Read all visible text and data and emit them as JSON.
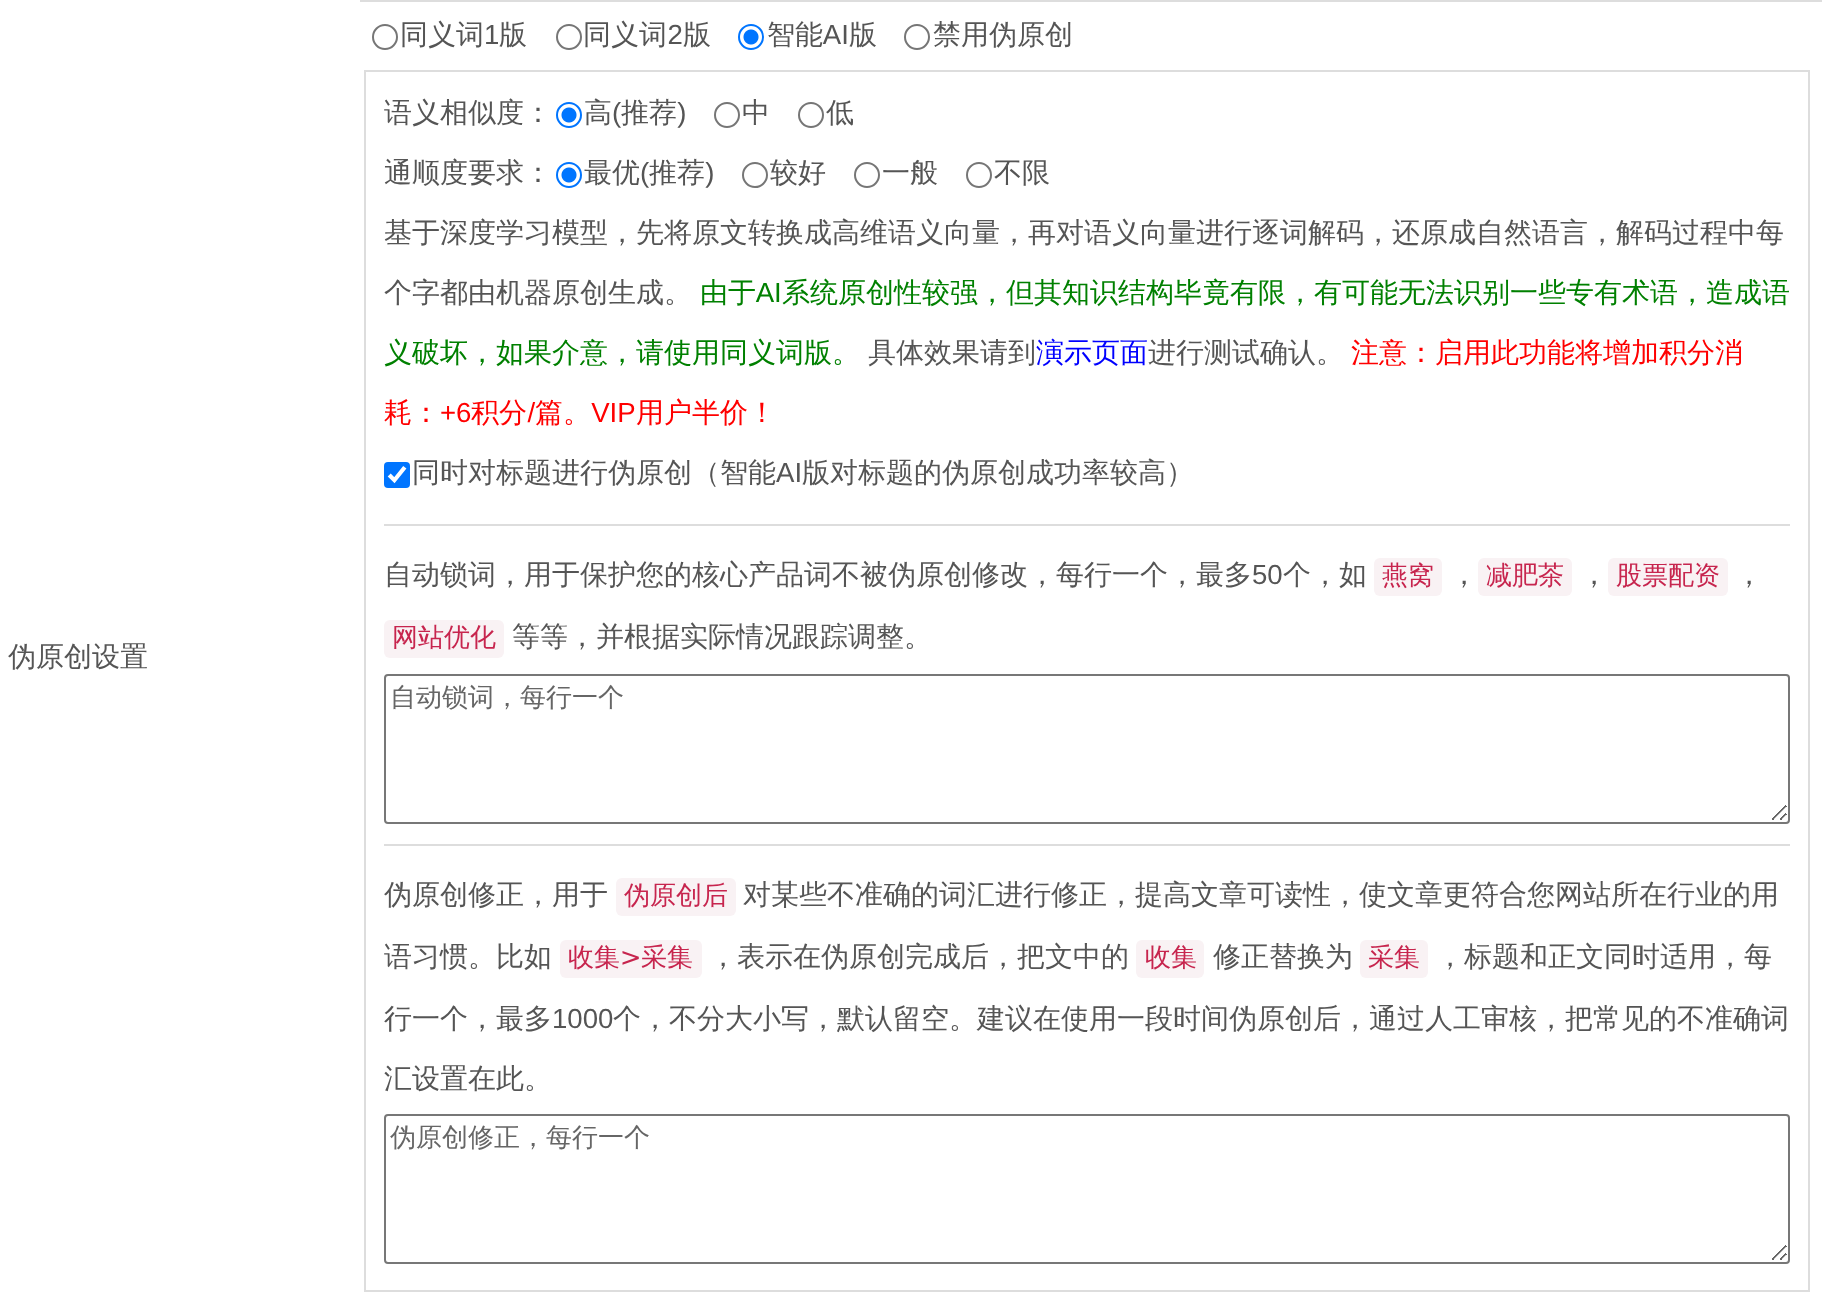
{
  "sidebar_label": "伪原创设置",
  "modes": [
    {
      "label": "同义词1版",
      "selected": false
    },
    {
      "label": "同义词2版",
      "selected": false
    },
    {
      "label": "智能AI版",
      "selected": true
    },
    {
      "label": "禁用伪原创",
      "selected": false
    }
  ],
  "ai_panel": {
    "similarity": {
      "label": "语义相似度：",
      "options": [
        {
          "label": "高(推荐)",
          "selected": true
        },
        {
          "label": "中",
          "selected": false
        },
        {
          "label": "低",
          "selected": false
        }
      ]
    },
    "fluency": {
      "label": "通顺度要求：",
      "options": [
        {
          "label": "最优(推荐)",
          "selected": true
        },
        {
          "label": "较好",
          "selected": false
        },
        {
          "label": "一般",
          "selected": false
        },
        {
          "label": "不限",
          "selected": false
        }
      ]
    },
    "description": [
      {
        "kind": "text",
        "text": "基于深度学习模型，先将原文转换成高维语义向量，再对语义向量进行逐词解码，还原成自然语言，解码过程中每个字都由机器原创生成。 "
      },
      {
        "kind": "green",
        "text": "由于AI系统原创性较强，但其知识结构毕竟有限，有可能无法识别一些专有术语，造成语义破坏，如果介意，请使用同义词版。"
      },
      {
        "kind": "text",
        "text": " 具体效果请到"
      },
      {
        "kind": "link",
        "text": "演示页面"
      },
      {
        "kind": "text",
        "text": "进行测试确认。 "
      },
      {
        "kind": "red",
        "text": "注意：启用此功能将增加积分消耗：+6积分/篇。VIP用户半价！"
      }
    ],
    "title_option": {
      "label": "同时对标题进行伪原创（智能AI版对标题的伪原创成功率较高）",
      "checked": true
    }
  },
  "lock_words": {
    "description": [
      {
        "kind": "text",
        "text": "自动锁词，用于保护您的核心产品词不被伪原创修改，每行一个，最多50个，如 "
      },
      {
        "kind": "code",
        "text": "燕窝"
      },
      {
        "kind": "text",
        "text": " ，"
      },
      {
        "kind": "code",
        "text": "减肥茶"
      },
      {
        "kind": "text",
        "text": " ，"
      },
      {
        "kind": "code",
        "text": "股票配资"
      },
      {
        "kind": "text",
        "text": " ，"
      },
      {
        "kind": "code",
        "text": "网站优化"
      },
      {
        "kind": "text",
        "text": " 等等，并根据实际情况跟踪调整。"
      }
    ],
    "textarea": {
      "placeholder": "自动锁词，每行一个"
    }
  },
  "corrections": {
    "description": [
      {
        "kind": "text",
        "text": "伪原创修正，用于 "
      },
      {
        "kind": "code",
        "text": "伪原创后"
      },
      {
        "kind": "text",
        "text": " 对某些不准确的词汇进行修正，提高文章可读性，使文章更符合您网站所在行业的用语习惯。比如 "
      },
      {
        "kind": "code",
        "text": "收集>采集"
      },
      {
        "kind": "text",
        "text": " ，表示在伪原创完成后，把文中的 "
      },
      {
        "kind": "code",
        "text": "收集"
      },
      {
        "kind": "text",
        "text": " 修正替换为 "
      },
      {
        "kind": "code",
        "text": "采集"
      },
      {
        "kind": "text",
        "text": " ，标题和正文同时适用，每行一个，最多1000个，不分大小写，默认留空。建议在使用一段时间伪原创后，通过人工审核，把常见的不准确词汇设置在此。"
      }
    ],
    "textarea": {
      "placeholder": "伪原创修正，每行一个"
    }
  }
}
